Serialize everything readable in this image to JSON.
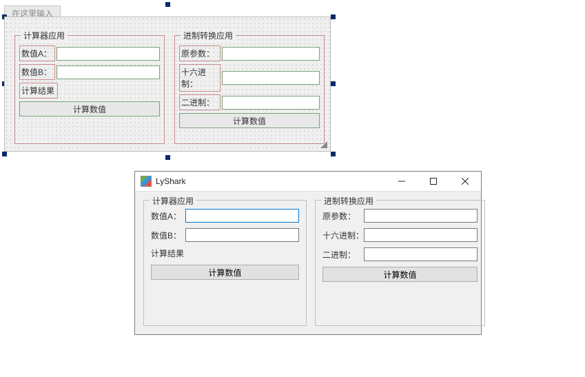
{
  "designer": {
    "tab_placeholder": "在这里输入",
    "group_calc": {
      "title": "计算器应用",
      "label_a": "数值A：",
      "label_b": "数值B：",
      "result_label": "计算结果",
      "button_label": "计算数值"
    },
    "group_conv": {
      "title": "进制转换应用",
      "label_orig": "原参数：",
      "label_hex": "十六进制：",
      "label_bin": "二进制：",
      "button_label": "计算数值"
    }
  },
  "window": {
    "title": "LyShark",
    "group_calc": {
      "title": "计算器应用",
      "label_a": "数值A：",
      "label_b": "数值B：",
      "result_label": "计算结果",
      "button_label": "计算数值",
      "value_a": "",
      "value_b": ""
    },
    "group_conv": {
      "title": "进制转换应用",
      "label_orig": "原参数：",
      "label_hex": "十六进制：",
      "label_bin": "二进制：",
      "button_label": "计算数值",
      "value_orig": "",
      "value_hex": "",
      "value_bin": ""
    }
  }
}
